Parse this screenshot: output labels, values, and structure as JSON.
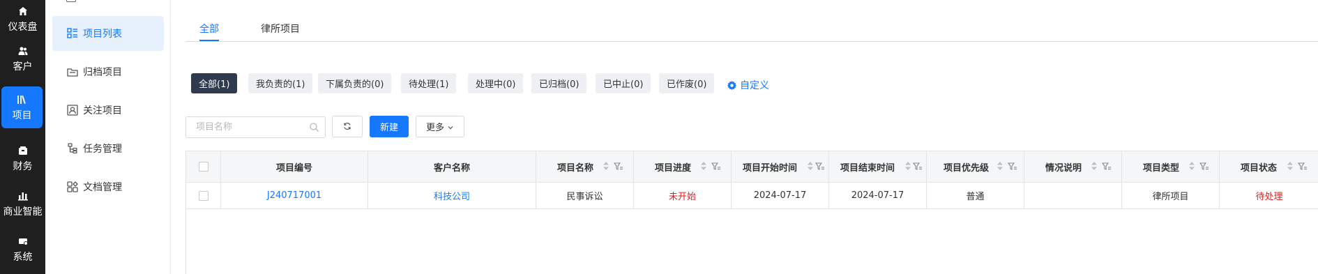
{
  "leftnav": {
    "items": [
      {
        "label": "仪表盘",
        "icon": "home-icon"
      },
      {
        "label": "客户",
        "icon": "users-icon"
      },
      {
        "label": "项目",
        "icon": "books-icon"
      },
      {
        "label": "财务",
        "icon": "wallet-icon"
      },
      {
        "label": "商业智能",
        "icon": "bar-chart-icon"
      },
      {
        "label": "系统",
        "icon": "system-icon"
      }
    ],
    "active_index": 2
  },
  "subnav": {
    "items": [
      {
        "label": "项目列表",
        "icon": "list-icon"
      },
      {
        "label": "归档项目",
        "icon": "archive-icon"
      },
      {
        "label": "关注项目",
        "icon": "follow-icon"
      },
      {
        "label": "任务管理",
        "icon": "task-icon"
      },
      {
        "label": "文档管理",
        "icon": "document-icon"
      }
    ],
    "active_index": 0
  },
  "tabs": [
    {
      "label": "全部"
    },
    {
      "label": "律所项目"
    }
  ],
  "filters": [
    {
      "label": "全部(1)"
    },
    {
      "label": "我负责的(1)"
    },
    {
      "label": "下属负责的(0)"
    },
    {
      "label": "待处理(1)"
    },
    {
      "label": "处理中(0)"
    },
    {
      "label": "已归档(0)"
    },
    {
      "label": "已中止(0)"
    },
    {
      "label": "已作废(0)"
    }
  ],
  "customize_label": "自定义",
  "toolbar": {
    "search_placeholder": "项目名称",
    "new_label": "新建",
    "more_label": "更多"
  },
  "table": {
    "columns": [
      "项目编号",
      "客户名称",
      "项目名称",
      "项目进度",
      "项目开始时间",
      "项目结束时间",
      "项目优先级",
      "情况说明",
      "项目类型",
      "项目状态"
    ],
    "rows": [
      [
        "J240717001",
        "科技公司",
        "民事诉讼",
        "未开始",
        "2024-07-17",
        "2024-07-17",
        "普通",
        "",
        "律所项目",
        "待处理"
      ]
    ]
  },
  "colors": {
    "accent": "#1677ff",
    "nav_bg": "#1f1f1f",
    "chip_active": "#2f3a4e",
    "status_red": "#e02020"
  }
}
